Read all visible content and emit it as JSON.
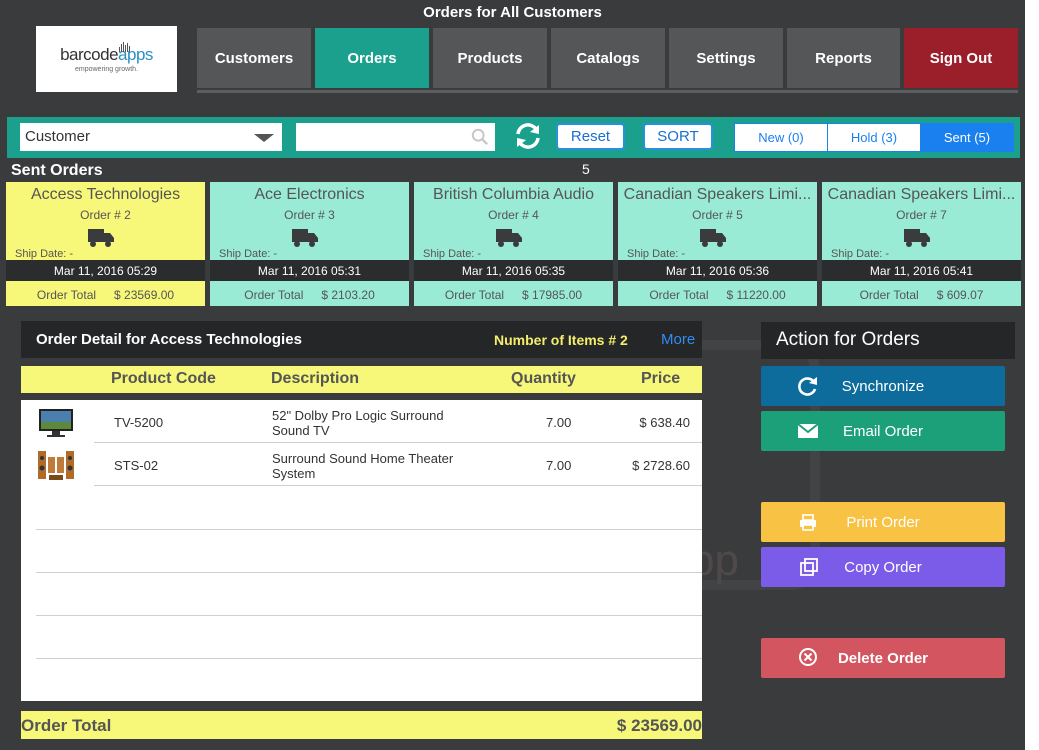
{
  "header": {
    "title": "Orders for All Customers",
    "logo_text_a": "barcode",
    "logo_text_b": "apps",
    "logo_tagline": "empowering growth."
  },
  "nav": [
    {
      "label": "Customers",
      "color": "#555657"
    },
    {
      "label": "Orders",
      "color": "#1ca08e"
    },
    {
      "label": "Products",
      "color": "#555657"
    },
    {
      "label": "Catalogs",
      "color": "#555657"
    },
    {
      "label": "Settings",
      "color": "#555657"
    },
    {
      "label": "Reports",
      "color": "#555657"
    },
    {
      "label": "Sign Out",
      "color": "#9b1f2b"
    }
  ],
  "filter": {
    "select_value": "Customer",
    "search_value": "",
    "reset_label": "Reset",
    "sort_label": "SORT",
    "segments": [
      {
        "label": "New (0)",
        "active": false
      },
      {
        "label": "Hold (3)",
        "active": false
      },
      {
        "label": "Sent (5)",
        "active": true
      }
    ]
  },
  "orders_section": {
    "title": "Sent Orders",
    "count": "5"
  },
  "order_cards": [
    {
      "name": "Access Technologies",
      "order_no": "Order # 2",
      "ship_date": "Ship Date: -",
      "date": "Mar 11, 2016 05:29",
      "total_label": "Order Total",
      "total": "$ 23569.00",
      "selected": true
    },
    {
      "name": "Ace Electronics",
      "order_no": "Order # 3",
      "ship_date": "Ship Date: -",
      "date": "Mar 11, 2016 05:31",
      "total_label": "Order Total",
      "total": "$ 2103.20",
      "selected": false
    },
    {
      "name": "British Columbia Audio",
      "order_no": "Order # 4",
      "ship_date": "Ship Date: -",
      "date": "Mar 11, 2016 05:35",
      "total_label": "Order Total",
      "total": "$ 17985.00",
      "selected": false
    },
    {
      "name": "Canadian Speakers Limi...",
      "order_no": "Order # 5",
      "ship_date": "Ship Date: -",
      "date": "Mar 11, 2016 05:36",
      "total_label": "Order Total",
      "total": "$ 11220.00",
      "selected": false
    },
    {
      "name": "Canadian Speakers Limi...",
      "order_no": "Order # 7",
      "ship_date": "Ship Date: -",
      "date": "Mar 11, 2016 05:41",
      "total_label": "Order Total",
      "total": "$ 609.07",
      "selected": false
    }
  ],
  "detail": {
    "title": "Order Detail for Access Technologies",
    "items_count": "Number of Items # 2",
    "more_label": "More",
    "columns": {
      "code": "Product Code",
      "description": "Description",
      "quantity": "Quantity",
      "price": "Price"
    },
    "rows": [
      {
        "code": "TV-5200",
        "description_1": "52\" Dolby Pro Logic Surround",
        "description_2": "Sound TV",
        "quantity": "7.00",
        "price": "$ 638.40",
        "thumb": "tv-icon"
      },
      {
        "code": "STS-02",
        "description_1": "Surround Sound Home Theater",
        "description_2": "System",
        "quantity": "7.00",
        "price": "$ 2728.60",
        "thumb": "speakers-icon"
      }
    ],
    "total_label": "Order Total",
    "total_value": "$ 23569.00"
  },
  "actions": {
    "title": "Action for Orders",
    "buttons": [
      {
        "label": "Synchronize",
        "color": "#0e6c9c",
        "icon": "sync-icon"
      },
      {
        "label": "Email Order",
        "color": "#1ca07a",
        "icon": "envelope-icon"
      },
      {
        "label": "Print Order",
        "color": "#f8c244",
        "icon": "printer-icon"
      },
      {
        "label": "Copy Order",
        "color": "#7a5ce8",
        "icon": "copy-icon"
      },
      {
        "label": "Delete Order",
        "color": "#d2555f",
        "icon": "delete-icon"
      }
    ]
  }
}
